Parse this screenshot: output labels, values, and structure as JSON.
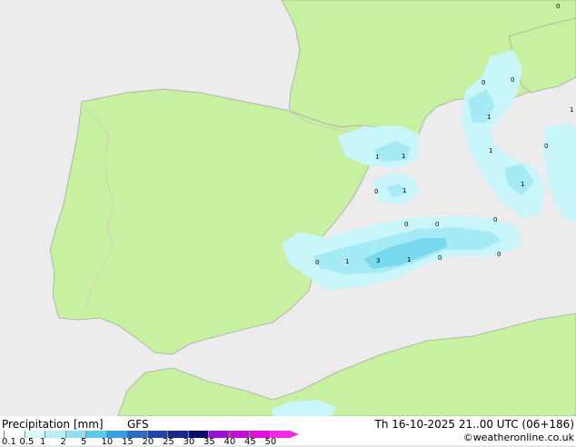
{
  "map": {
    "colors": {
      "sea": "#ececec",
      "land": "#c7f0a0",
      "coast": "#a8a8a8",
      "border": "#c8c8c8",
      "precip_light": "#c9f6fb",
      "precip_mid": "#a4ebf5",
      "precip_heavy": "#78d9ee"
    },
    "contour_labels": [
      "0",
      "1",
      "1",
      "1",
      "1",
      "0",
      "0",
      "0",
      "1",
      "1",
      "0",
      "0",
      "0",
      "1",
      "3",
      "1",
      "0",
      "0",
      "0",
      "0",
      "1"
    ]
  },
  "footer": {
    "title": "Precipitation [mm]",
    "model": "GFS",
    "datetime": "Th 16-10-2025 21..00 UTC (06+186)",
    "credit": "©weatheronline.co.uk",
    "legend": {
      "ticks": [
        "0.1",
        "0.5",
        "1",
        "2",
        "5",
        "10",
        "15",
        "20",
        "25",
        "30",
        "35",
        "40",
        "45",
        "50"
      ],
      "colors": [
        "#ffffff",
        "#d8f7fb",
        "#b8eef7",
        "#8fe1f2",
        "#5fc9ea",
        "#3aa0db",
        "#2c6fc2",
        "#1f45a8",
        "#152a8a",
        "#0c0f66",
        "#9a12c9",
        "#c20fd4",
        "#e20fd8",
        "#f52ae0"
      ]
    }
  }
}
